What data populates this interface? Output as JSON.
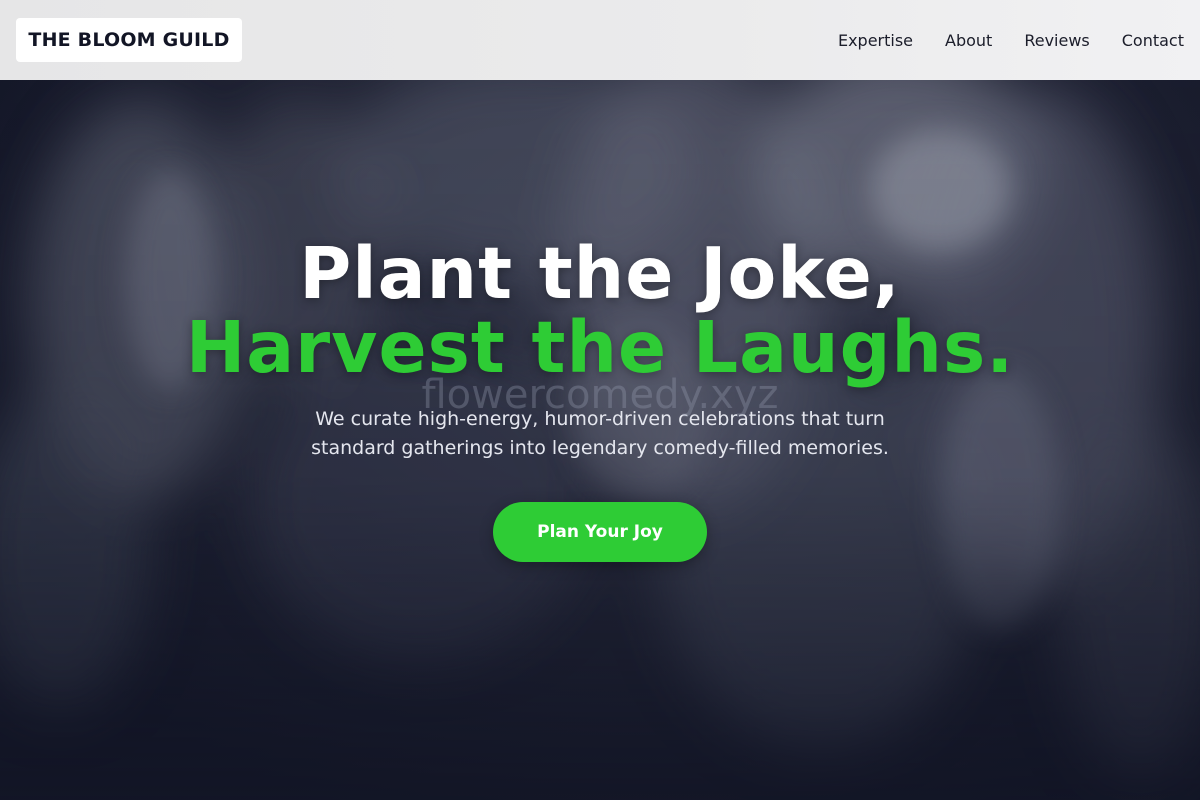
{
  "header": {
    "logo": "THE BLOOM GUILD",
    "nav": [
      {
        "label": "Expertise"
      },
      {
        "label": "About"
      },
      {
        "label": "Reviews"
      },
      {
        "label": "Contact"
      }
    ]
  },
  "hero": {
    "headline_line1": "Plant the Joke,",
    "headline_line2": "Harvest the Laughs.",
    "watermark": "flowercomedy.xyz",
    "subtitle": "We curate high-energy, humor-driven celebrations that turn standard gatherings into legendary comedy-filled memories.",
    "cta_label": "Plan Your Joy"
  },
  "colors": {
    "accent": "#2ecc35",
    "background": "#121525",
    "header": "#e9e9ea"
  }
}
